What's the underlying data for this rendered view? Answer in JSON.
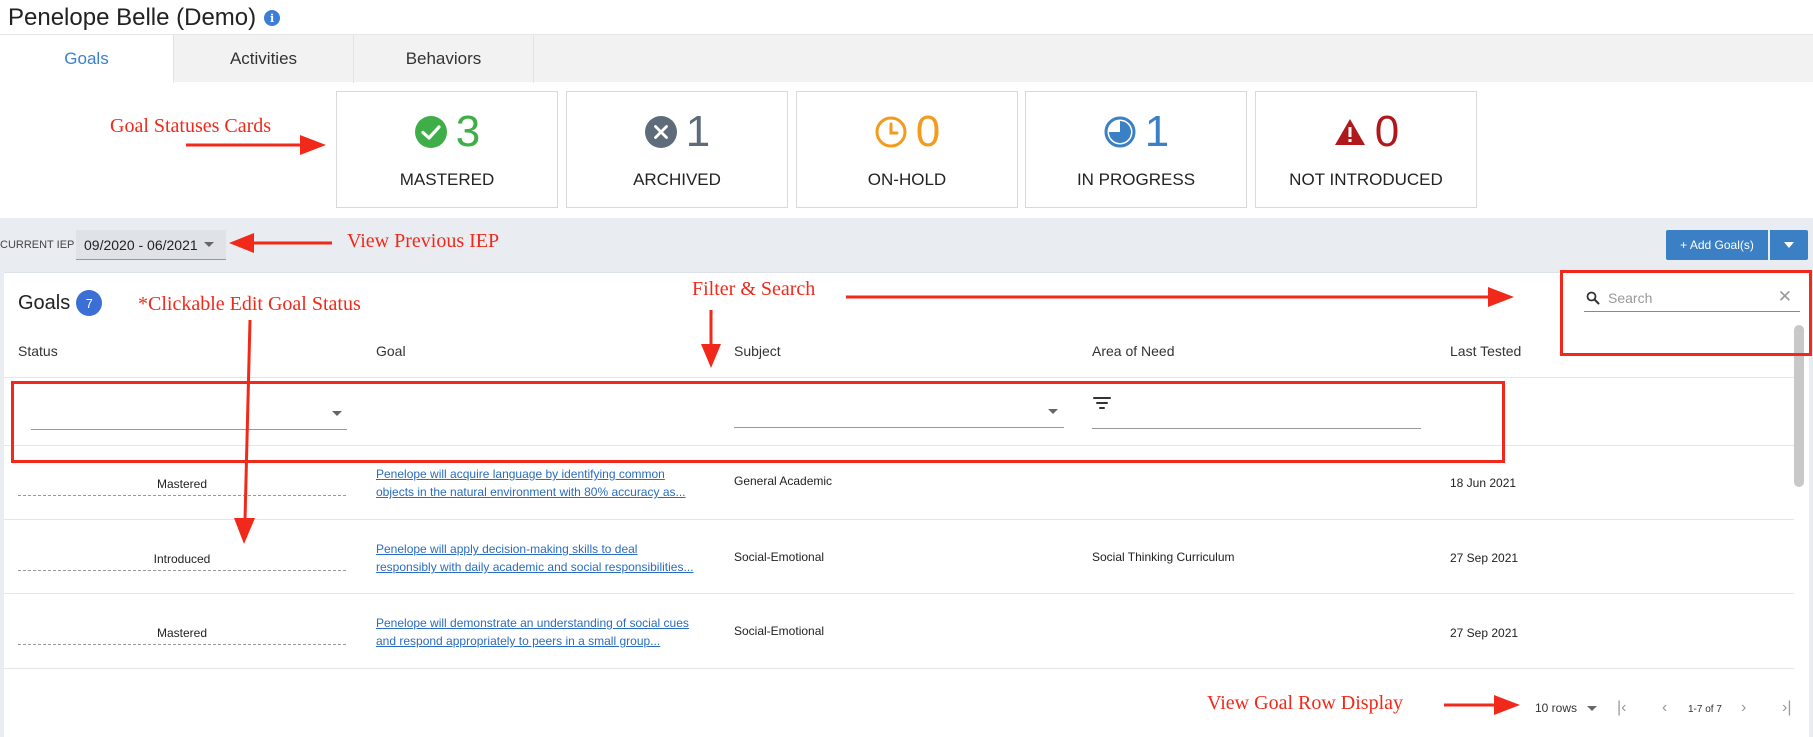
{
  "header": {
    "title": "Penelope Belle (Demo)",
    "info_glyph": "i"
  },
  "tabs": [
    {
      "label": "Goals",
      "active": true
    },
    {
      "label": "Activities",
      "active": false
    },
    {
      "label": "Behaviors",
      "active": false
    }
  ],
  "status_cards": [
    {
      "count": "3",
      "label": "MASTERED",
      "icon": "check-circle-icon",
      "color": "#3fae49"
    },
    {
      "count": "1",
      "label": "ARCHIVED",
      "icon": "x-circle-icon",
      "color": "#5d6b7a"
    },
    {
      "count": "0",
      "label": "ON-HOLD",
      "icon": "clock-icon",
      "color": "#f29b1d"
    },
    {
      "count": "1",
      "label": "IN PROGRESS",
      "icon": "pie-progress-icon",
      "color": "#3b7fc4"
    },
    {
      "count": "0",
      "label": "NOT INTRODUCED",
      "icon": "warning-icon",
      "color": "#b0181c"
    }
  ],
  "iep": {
    "label": "CURRENT IEP",
    "value": "09/2020 - 06/2021"
  },
  "add_goal": {
    "label": "+ Add Goal(s)"
  },
  "goals_panel": {
    "title": "Goals",
    "count": "7",
    "search_placeholder": "Search",
    "clear_glyph": "✕",
    "columns": [
      "Status",
      "Goal",
      "Subject",
      "Area of Need",
      "Last Tested"
    ],
    "rows": [
      {
        "status": "Mastered",
        "goal_line1": "Penelope will acquire language by identifying common",
        "goal_line2": "objects in the natural environment with 80% accuracy as...",
        "subject": "General Academic",
        "area": "",
        "last_tested": "18 Jun 2021"
      },
      {
        "status": "Introduced",
        "goal_line1": "Penelope will apply decision-making skills to deal",
        "goal_line2": "responsibly with daily academic and social responsibilities...",
        "subject": "Social-Emotional",
        "area": "Social Thinking Curriculum",
        "last_tested": "27 Sep 2021"
      },
      {
        "status": "Mastered",
        "goal_line1": "Penelope will demonstrate an understanding of social cues",
        "goal_line2": "and respond appropriately to peers in a small group...",
        "subject": "Social-Emotional",
        "area": "",
        "last_tested": "27 Sep 2021"
      }
    ]
  },
  "pagination": {
    "rows_label": "10 rows",
    "range": "1-7 of 7"
  },
  "annotations": {
    "status_cards": "Goal Statuses Cards",
    "previous_iep": "View Previous IEP",
    "filter_search": "Filter & Search",
    "edit_status": "*Clickable Edit Goal Status",
    "row_display": "View Goal Row Display"
  },
  "colors": {
    "accent": "#3b7fc4",
    "annotation": "#f0291a"
  }
}
